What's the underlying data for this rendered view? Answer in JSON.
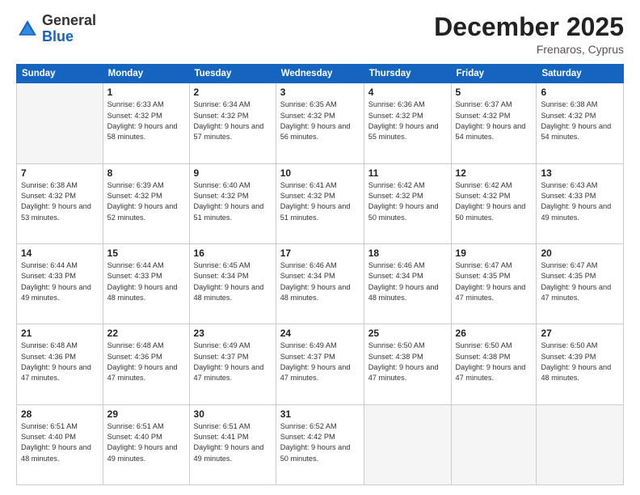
{
  "header": {
    "logo_general": "General",
    "logo_blue": "Blue",
    "month_title": "December 2025",
    "location": "Frenaros, Cyprus"
  },
  "days_of_week": [
    "Sunday",
    "Monday",
    "Tuesday",
    "Wednesday",
    "Thursday",
    "Friday",
    "Saturday"
  ],
  "weeks": [
    [
      {
        "day": "",
        "sunrise": "",
        "sunset": "",
        "daylight": "",
        "empty": true
      },
      {
        "day": "1",
        "sunrise": "Sunrise: 6:33 AM",
        "sunset": "Sunset: 4:32 PM",
        "daylight": "Daylight: 9 hours and 58 minutes."
      },
      {
        "day": "2",
        "sunrise": "Sunrise: 6:34 AM",
        "sunset": "Sunset: 4:32 PM",
        "daylight": "Daylight: 9 hours and 57 minutes."
      },
      {
        "day": "3",
        "sunrise": "Sunrise: 6:35 AM",
        "sunset": "Sunset: 4:32 PM",
        "daylight": "Daylight: 9 hours and 56 minutes."
      },
      {
        "day": "4",
        "sunrise": "Sunrise: 6:36 AM",
        "sunset": "Sunset: 4:32 PM",
        "daylight": "Daylight: 9 hours and 55 minutes."
      },
      {
        "day": "5",
        "sunrise": "Sunrise: 6:37 AM",
        "sunset": "Sunset: 4:32 PM",
        "daylight": "Daylight: 9 hours and 54 minutes."
      },
      {
        "day": "6",
        "sunrise": "Sunrise: 6:38 AM",
        "sunset": "Sunset: 4:32 PM",
        "daylight": "Daylight: 9 hours and 54 minutes."
      }
    ],
    [
      {
        "day": "7",
        "sunrise": "Sunrise: 6:38 AM",
        "sunset": "Sunset: 4:32 PM",
        "daylight": "Daylight: 9 hours and 53 minutes."
      },
      {
        "day": "8",
        "sunrise": "Sunrise: 6:39 AM",
        "sunset": "Sunset: 4:32 PM",
        "daylight": "Daylight: 9 hours and 52 minutes."
      },
      {
        "day": "9",
        "sunrise": "Sunrise: 6:40 AM",
        "sunset": "Sunset: 4:32 PM",
        "daylight": "Daylight: 9 hours and 51 minutes."
      },
      {
        "day": "10",
        "sunrise": "Sunrise: 6:41 AM",
        "sunset": "Sunset: 4:32 PM",
        "daylight": "Daylight: 9 hours and 51 minutes."
      },
      {
        "day": "11",
        "sunrise": "Sunrise: 6:42 AM",
        "sunset": "Sunset: 4:32 PM",
        "daylight": "Daylight: 9 hours and 50 minutes."
      },
      {
        "day": "12",
        "sunrise": "Sunrise: 6:42 AM",
        "sunset": "Sunset: 4:32 PM",
        "daylight": "Daylight: 9 hours and 50 minutes."
      },
      {
        "day": "13",
        "sunrise": "Sunrise: 6:43 AM",
        "sunset": "Sunset: 4:33 PM",
        "daylight": "Daylight: 9 hours and 49 minutes."
      }
    ],
    [
      {
        "day": "14",
        "sunrise": "Sunrise: 6:44 AM",
        "sunset": "Sunset: 4:33 PM",
        "daylight": "Daylight: 9 hours and 49 minutes."
      },
      {
        "day": "15",
        "sunrise": "Sunrise: 6:44 AM",
        "sunset": "Sunset: 4:33 PM",
        "daylight": "Daylight: 9 hours and 48 minutes."
      },
      {
        "day": "16",
        "sunrise": "Sunrise: 6:45 AM",
        "sunset": "Sunset: 4:34 PM",
        "daylight": "Daylight: 9 hours and 48 minutes."
      },
      {
        "day": "17",
        "sunrise": "Sunrise: 6:46 AM",
        "sunset": "Sunset: 4:34 PM",
        "daylight": "Daylight: 9 hours and 48 minutes."
      },
      {
        "day": "18",
        "sunrise": "Sunrise: 6:46 AM",
        "sunset": "Sunset: 4:34 PM",
        "daylight": "Daylight: 9 hours and 48 minutes."
      },
      {
        "day": "19",
        "sunrise": "Sunrise: 6:47 AM",
        "sunset": "Sunset: 4:35 PM",
        "daylight": "Daylight: 9 hours and 47 minutes."
      },
      {
        "day": "20",
        "sunrise": "Sunrise: 6:47 AM",
        "sunset": "Sunset: 4:35 PM",
        "daylight": "Daylight: 9 hours and 47 minutes."
      }
    ],
    [
      {
        "day": "21",
        "sunrise": "Sunrise: 6:48 AM",
        "sunset": "Sunset: 4:36 PM",
        "daylight": "Daylight: 9 hours and 47 minutes."
      },
      {
        "day": "22",
        "sunrise": "Sunrise: 6:48 AM",
        "sunset": "Sunset: 4:36 PM",
        "daylight": "Daylight: 9 hours and 47 minutes."
      },
      {
        "day": "23",
        "sunrise": "Sunrise: 6:49 AM",
        "sunset": "Sunset: 4:37 PM",
        "daylight": "Daylight: 9 hours and 47 minutes."
      },
      {
        "day": "24",
        "sunrise": "Sunrise: 6:49 AM",
        "sunset": "Sunset: 4:37 PM",
        "daylight": "Daylight: 9 hours and 47 minutes."
      },
      {
        "day": "25",
        "sunrise": "Sunrise: 6:50 AM",
        "sunset": "Sunset: 4:38 PM",
        "daylight": "Daylight: 9 hours and 47 minutes."
      },
      {
        "day": "26",
        "sunrise": "Sunrise: 6:50 AM",
        "sunset": "Sunset: 4:38 PM",
        "daylight": "Daylight: 9 hours and 47 minutes."
      },
      {
        "day": "27",
        "sunrise": "Sunrise: 6:50 AM",
        "sunset": "Sunset: 4:39 PM",
        "daylight": "Daylight: 9 hours and 48 minutes."
      }
    ],
    [
      {
        "day": "28",
        "sunrise": "Sunrise: 6:51 AM",
        "sunset": "Sunset: 4:40 PM",
        "daylight": "Daylight: 9 hours and 48 minutes."
      },
      {
        "day": "29",
        "sunrise": "Sunrise: 6:51 AM",
        "sunset": "Sunset: 4:40 PM",
        "daylight": "Daylight: 9 hours and 49 minutes."
      },
      {
        "day": "30",
        "sunrise": "Sunrise: 6:51 AM",
        "sunset": "Sunset: 4:41 PM",
        "daylight": "Daylight: 9 hours and 49 minutes."
      },
      {
        "day": "31",
        "sunrise": "Sunrise: 6:52 AM",
        "sunset": "Sunset: 4:42 PM",
        "daylight": "Daylight: 9 hours and 50 minutes."
      },
      {
        "day": "",
        "sunrise": "",
        "sunset": "",
        "daylight": "",
        "empty": true
      },
      {
        "day": "",
        "sunrise": "",
        "sunset": "",
        "daylight": "",
        "empty": true
      },
      {
        "day": "",
        "sunrise": "",
        "sunset": "",
        "daylight": "",
        "empty": true
      }
    ]
  ]
}
